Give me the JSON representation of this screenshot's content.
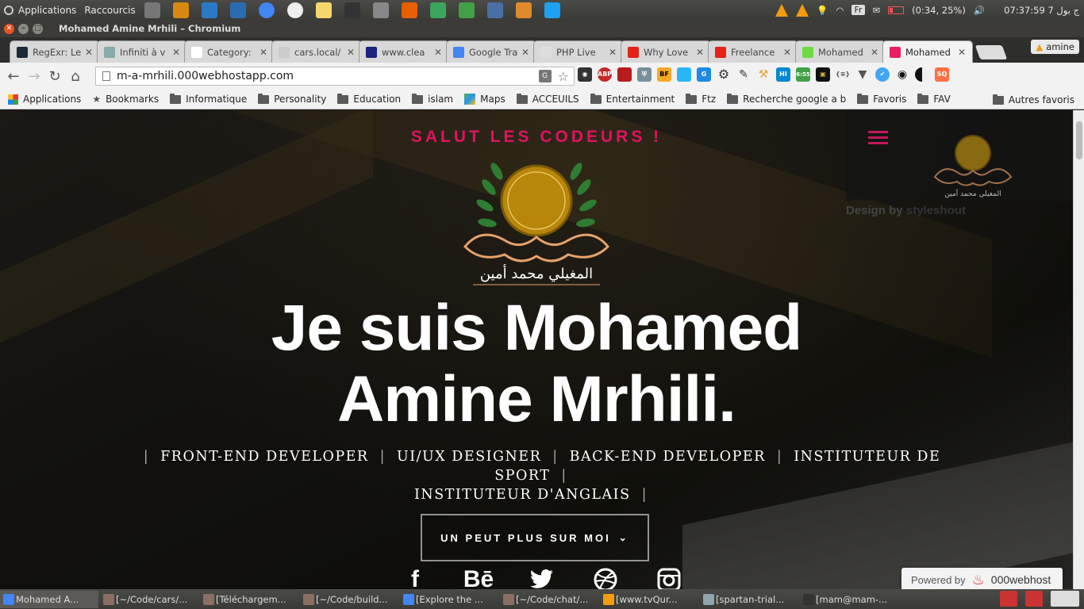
{
  "desktop": {
    "menu_applications": "Applications",
    "menu_shortcuts": "Raccourcis",
    "launchers": [
      "files-icon",
      "folder-icon",
      "vscode-icon",
      "virtualbox-icon",
      "chromium-icon",
      "opera-icon",
      "notes-icon",
      "inkscape-icon",
      "gimp-icon",
      "firefox-icon",
      "checkbox-icon",
      "todo-icon",
      "tool-icon",
      "sublime-icon",
      "web-icon"
    ],
    "tray": {
      "battery": "(0:34, 25%)",
      "clock": "07:37:59 7 ج بول",
      "keyboard": "Fr"
    }
  },
  "window": {
    "title": "Mohamed Amine Mrhili – Chromium"
  },
  "tabs": [
    {
      "label": "RegExr: Le",
      "fav": "#1d2a3a"
    },
    {
      "label": "Infiniti à v",
      "fav": "#8aa"
    },
    {
      "label": "Category:",
      "fav": "#fff"
    },
    {
      "label": "cars.local/",
      "fav": "#ccc"
    },
    {
      "label": "www.clea",
      "fav": "#1a237e"
    },
    {
      "label": "Google Tra",
      "fav": "#4285f4"
    },
    {
      "label": "PHP Live",
      "fav": "#ddd"
    },
    {
      "label": "Why Love",
      "fav": "#e62117"
    },
    {
      "label": "Freelance",
      "fav": "#e62117"
    },
    {
      "label": "Mohamed",
      "fav": "#6fda44"
    },
    {
      "label": "Mohamed",
      "fav": "#e91e63"
    }
  ],
  "profile": {
    "name": "amine"
  },
  "omnibox": {
    "url": "m-a-mrhili.000webhostapp.com"
  },
  "extensions": [
    "spy-icon",
    "adblock-icon",
    "book-icon",
    "shield-icon",
    "bf-icon",
    "window-icon",
    "translate-icon",
    "gear-icon",
    "pencil-icon",
    "hammer-icon",
    "hi-icon",
    "clock-icon",
    "kaaba-icon",
    "json-icon",
    "v-icon",
    "check-icon",
    "eye-icon",
    "contrast-icon",
    "sq-icon"
  ],
  "extension_texts": {
    "abp": "ABP",
    "bf": "BF",
    "hi": "HI",
    "clock": "6:55",
    "json": "{≡}",
    "sq": "SQ"
  },
  "bookmarks": [
    "Applications",
    "Bookmarks",
    "Informatique",
    "Personality",
    "Education",
    "islam",
    "Maps",
    "ACCEUILS",
    "Entertainment",
    "Ftz",
    "Recherche google a b",
    "Favoris",
    "FAV"
  ],
  "bookmarks_right": "Autres favoris",
  "page": {
    "intro": "SALUT LES CODEURS !",
    "logo_text": "المغيلي محمد أمين",
    "headline_line1": "Je suis Mohamed",
    "headline_line2": "Amine Mrhili.",
    "roles_sep": "|",
    "roles_line1": [
      "FRONT-END DEVELOPER",
      "UI/UX DESIGNER",
      "BACK-END DEVELOPER",
      "INSTITUTEUR DE SPORT"
    ],
    "roles_line2": [
      "INSTITUTEUR D'ANGLAIS"
    ],
    "cta": "UN PEUT PLUS SUR MOI",
    "cta_icon": "chevron-down-icon",
    "socials": [
      {
        "name": "facebook",
        "glyph": "f"
      },
      {
        "name": "behance",
        "glyph": "Bē"
      },
      {
        "name": "twitter",
        "glyph": "twitter-icon"
      },
      {
        "name": "dribbble",
        "glyph": "dribbble-icon"
      },
      {
        "name": "instagram",
        "glyph": "instagram-icon"
      }
    ],
    "credit_prefix": "Design by",
    "credit_link": "styleshout",
    "powered_label": "Powered by",
    "powered_brand": "000webhost",
    "accent": "#e0135f"
  },
  "taskbar": [
    "Mohamed A...",
    "[~/Code/cars/...",
    "[Téléchargem...",
    "[~/Code/build...",
    "[Explore the ...",
    "[~/Code/chat/...",
    "[www.tvQur...",
    "[spartan-trial...",
    "[mam@mam-..."
  ]
}
